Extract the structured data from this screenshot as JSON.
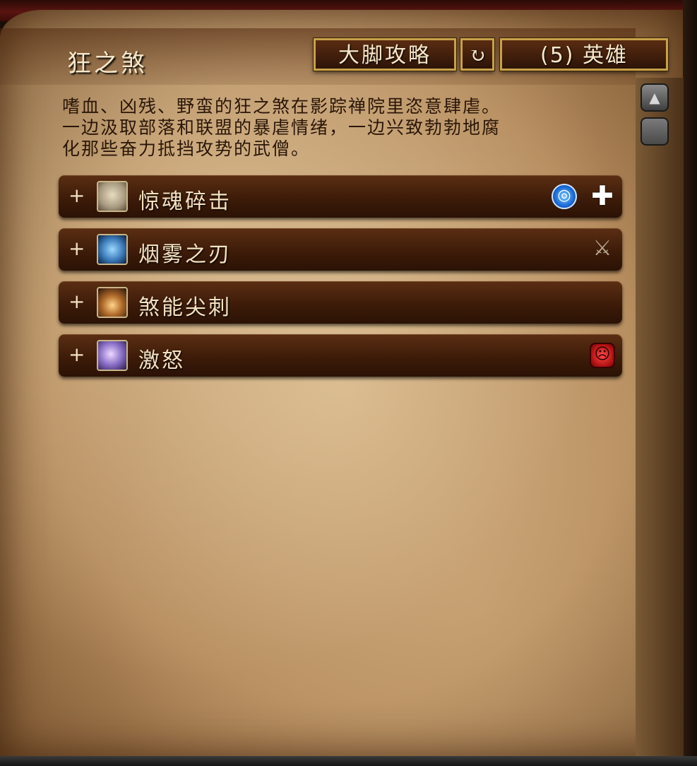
{
  "boss": {
    "name": "狂之煞",
    "description_lines": [
      "嗜血、凶残、野蛮的狂之煞在影踪禅院里恣意肆虐。",
      "一边汲取部落和联盟的暴虐情绪，一边兴致勃勃地腐",
      "化那些奋力抵挡攻势的武僧。"
    ]
  },
  "toolbar": {
    "guide_label": "大脚攻略",
    "refresh_icon": "↻",
    "difficulty_label": "(5) 英雄"
  },
  "abilities": [
    {
      "expand": "+",
      "name": "惊魂碎击",
      "icon": "face-icon",
      "tags": [
        "interrupt-icon",
        "healer-icon"
      ]
    },
    {
      "expand": "+",
      "name": "烟雾之刃",
      "icon": "blade-icon",
      "tags": [
        "weapon-icon"
      ]
    },
    {
      "expand": "+",
      "name": "煞能尖刺",
      "icon": "spike-icon",
      "tags": []
    },
    {
      "expand": "+",
      "name": "激怒",
      "icon": "rage-icon",
      "tags": [
        "enrage-icon"
      ]
    }
  ],
  "tag_glyphs": {
    "interrupt": "◎",
    "healer": "✚",
    "weapon": "⚔",
    "enrage": "☹"
  },
  "colors": {
    "parchment": "#c9a97c",
    "row_bg": "#4a2410",
    "gold_border": "#c8a14a"
  }
}
